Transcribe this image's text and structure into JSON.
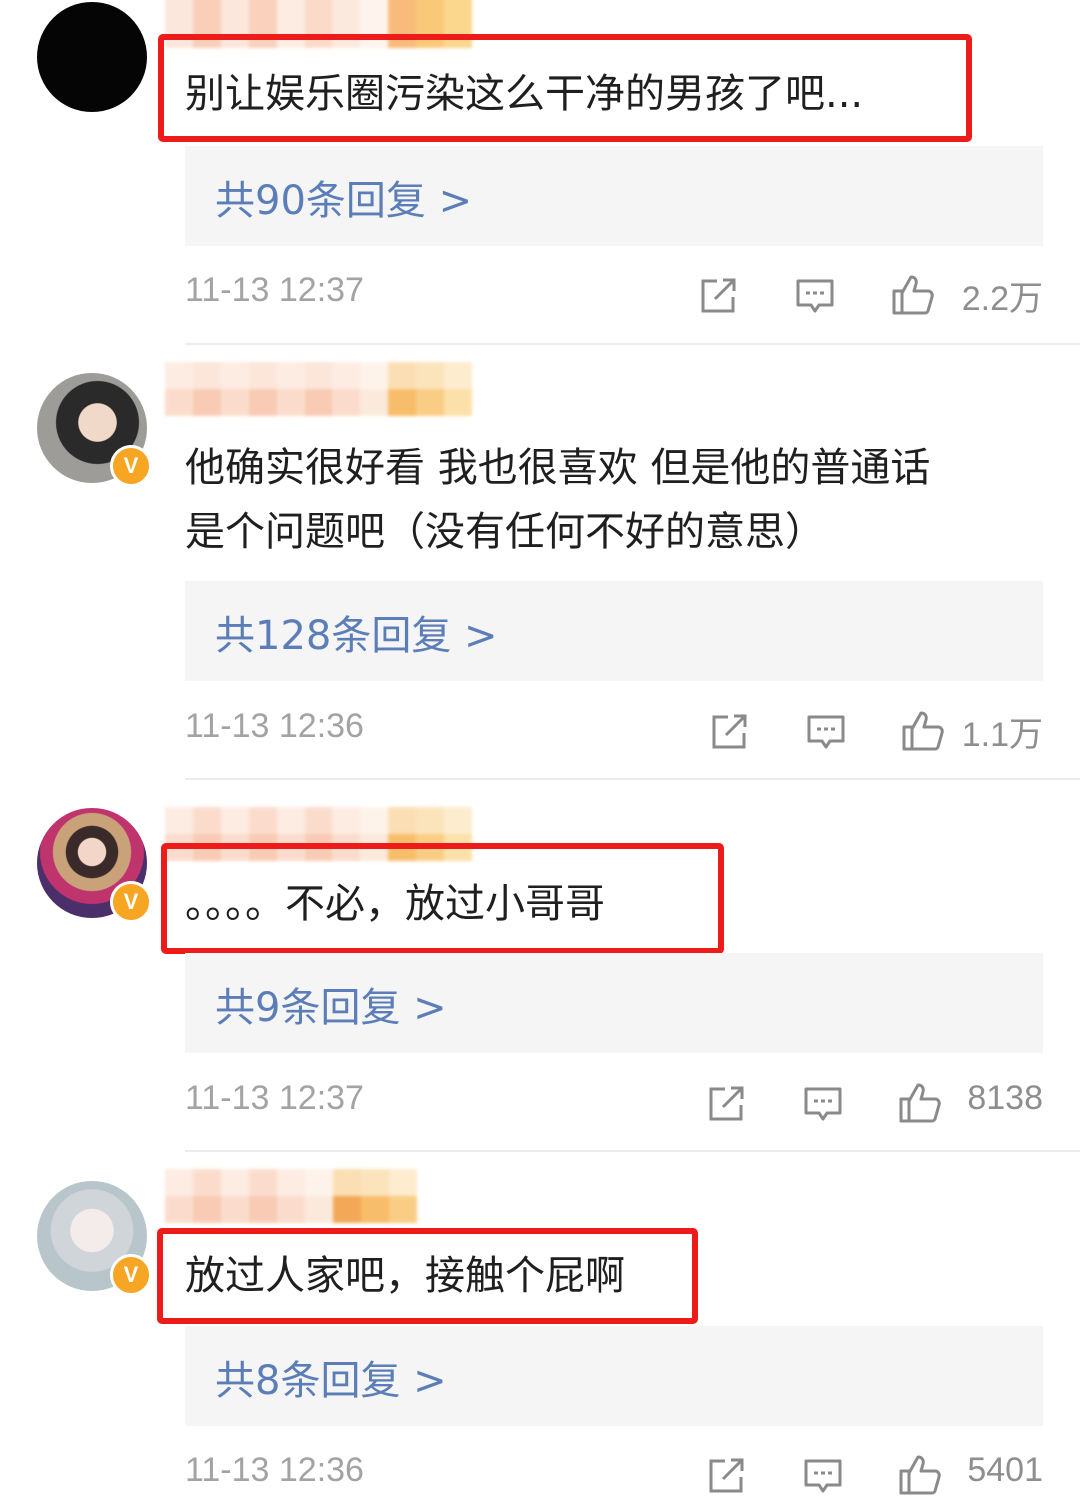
{
  "comments": [
    {
      "text": "别让娱乐圈污染这么干净的男孩了吧...",
      "replies_label": "共90条回复 >",
      "time": "11-13 12:37",
      "likes": "2.2万",
      "verified": false,
      "highlighted": true
    },
    {
      "text": "他确实很好看 我也很喜欢 但是他的普通话\n是个问题吧（没有任何不好的意思）",
      "replies_label": "共128条回复 >",
      "time": "11-13 12:36",
      "likes": "1.1万",
      "verified": true,
      "highlighted": false
    },
    {
      "text": "。。。。不必，放过小哥哥",
      "replies_label": "共9条回复 >",
      "time": "11-13 12:37",
      "likes": "8138",
      "verified": true,
      "highlighted": true
    },
    {
      "text": "放过人家吧，接触个屁啊",
      "replies_label": "共8条回复 >",
      "time": "11-13 12:36",
      "likes": "5401",
      "verified": true,
      "highlighted": true
    }
  ],
  "icons": [
    "share-icon",
    "comment-icon",
    "like-icon"
  ],
  "colors": {
    "link": "#5b7db8",
    "highlight_box": "#ee1b1b",
    "verified_badge": "#f6a623",
    "reply_bg": "#f5f5f5",
    "meta_text": "#a3a3a3"
  },
  "badge": {
    "verified_glyph": "V"
  }
}
